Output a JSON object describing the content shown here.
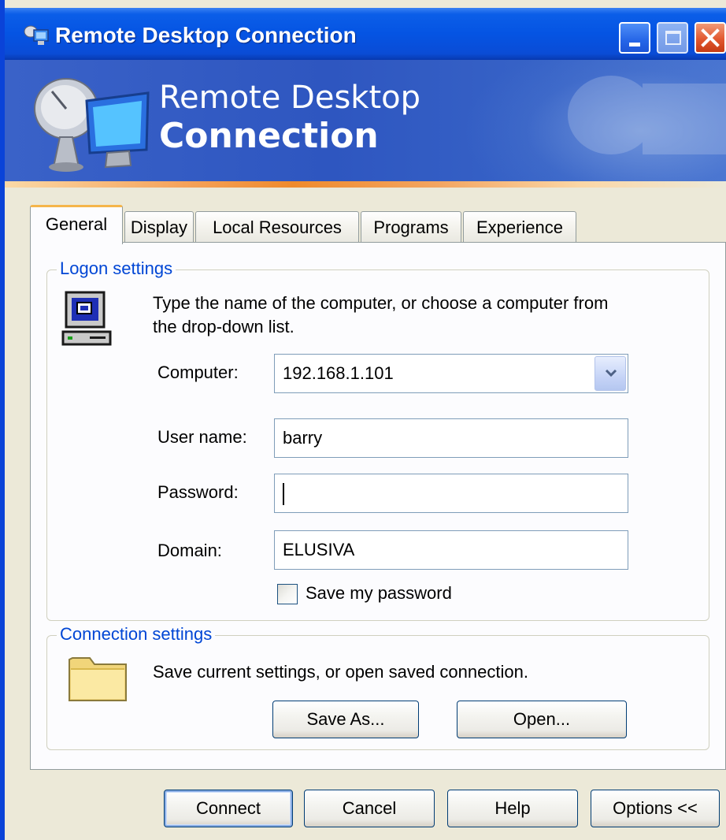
{
  "window": {
    "title": "Remote Desktop Connection"
  },
  "banner": {
    "line1": "Remote Desktop",
    "line2": "Connection"
  },
  "tabs": [
    {
      "label": "General",
      "active": true
    },
    {
      "label": "Display",
      "active": false
    },
    {
      "label": "Local Resources",
      "active": false
    },
    {
      "label": "Programs",
      "active": false
    },
    {
      "label": "Experience",
      "active": false
    }
  ],
  "logon": {
    "legend": "Logon settings",
    "instruction_line1": "Type the name of the computer, or choose a computer from",
    "instruction_line2": "the drop-down list.",
    "computer_label": "Computer:",
    "computer_value": "192.168.1.101",
    "username_label": "User name:",
    "username_value": "barry",
    "password_label": "Password:",
    "password_value": "",
    "domain_label": "Domain:",
    "domain_value": "ELUSIVA",
    "save_password_label": "Save my password",
    "save_password_checked": false
  },
  "connection": {
    "legend": "Connection settings",
    "description": "Save current settings, or open saved connection.",
    "save_as_label": "Save As...",
    "open_label": "Open..."
  },
  "buttons": {
    "connect": "Connect",
    "cancel": "Cancel",
    "help": "Help",
    "options": "Options <<"
  },
  "icons": {
    "title": "remote-desktop-icon",
    "banner": "satellite-dish-monitor-icon",
    "computer": "computer-icon",
    "folder": "folder-icon",
    "minimize": "minimize-icon",
    "maximize": "maximize-icon",
    "close": "close-icon",
    "dropdown": "chevron-down-icon"
  },
  "colors": {
    "titlebar": "#0554e3",
    "banner": "#2e56c0",
    "accent_stripe": "#ef8a2c",
    "legend_text": "#0046d5",
    "dialog_bg": "#ece9d8"
  }
}
